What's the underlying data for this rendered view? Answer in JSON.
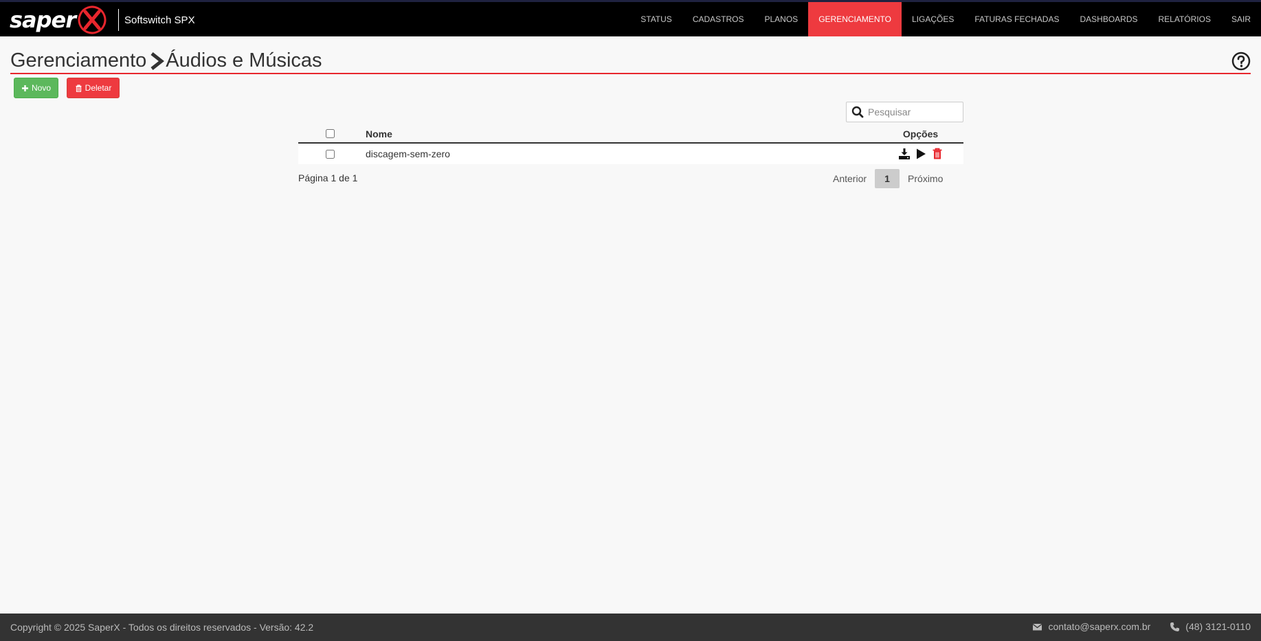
{
  "brand": {
    "logo": "saper",
    "logo_mark": "X",
    "subtitle": "Softswitch SPX"
  },
  "nav": {
    "items": [
      {
        "label": "STATUS",
        "active": false
      },
      {
        "label": "CADASTROS",
        "active": false
      },
      {
        "label": "PLANOS",
        "active": false
      },
      {
        "label": "GERENCIAMENTO",
        "active": true
      },
      {
        "label": "LIGAÇÕES",
        "active": false
      },
      {
        "label": "FATURAS FECHADAS",
        "active": false
      },
      {
        "label": "DASHBOARDS",
        "active": false
      },
      {
        "label": "RELATÓRIOS",
        "active": false
      },
      {
        "label": "SAIR",
        "active": false
      }
    ]
  },
  "header": {
    "section": "Gerenciamento",
    "page": "Áudios e Músicas",
    "help_icon": "question-circle-icon"
  },
  "toolbar": {
    "new_label": "Novo",
    "delete_label": "Deletar"
  },
  "search": {
    "placeholder": "Pesquisar",
    "value": ""
  },
  "table": {
    "columns": {
      "name": "Nome",
      "options": "Opções"
    },
    "rows": [
      {
        "name": "discagem-sem-zero",
        "checked": false,
        "options": [
          "download-icon",
          "play-icon",
          "trash-icon"
        ]
      }
    ]
  },
  "pagination": {
    "info": "Página 1 de 1",
    "prev": "Anterior",
    "current": "1",
    "next": "Próximo"
  },
  "footer": {
    "copyright": "Copyright © 2025 SaperX - Todos os direitos reservados - Versão: 42.2",
    "email": "contato@saperx.com.br",
    "phone": "(48) 3121-0110"
  },
  "colors": {
    "accent": "#ee3a3f",
    "success": "#5cb85c",
    "navbar": "#000000",
    "footer": "#333333"
  }
}
